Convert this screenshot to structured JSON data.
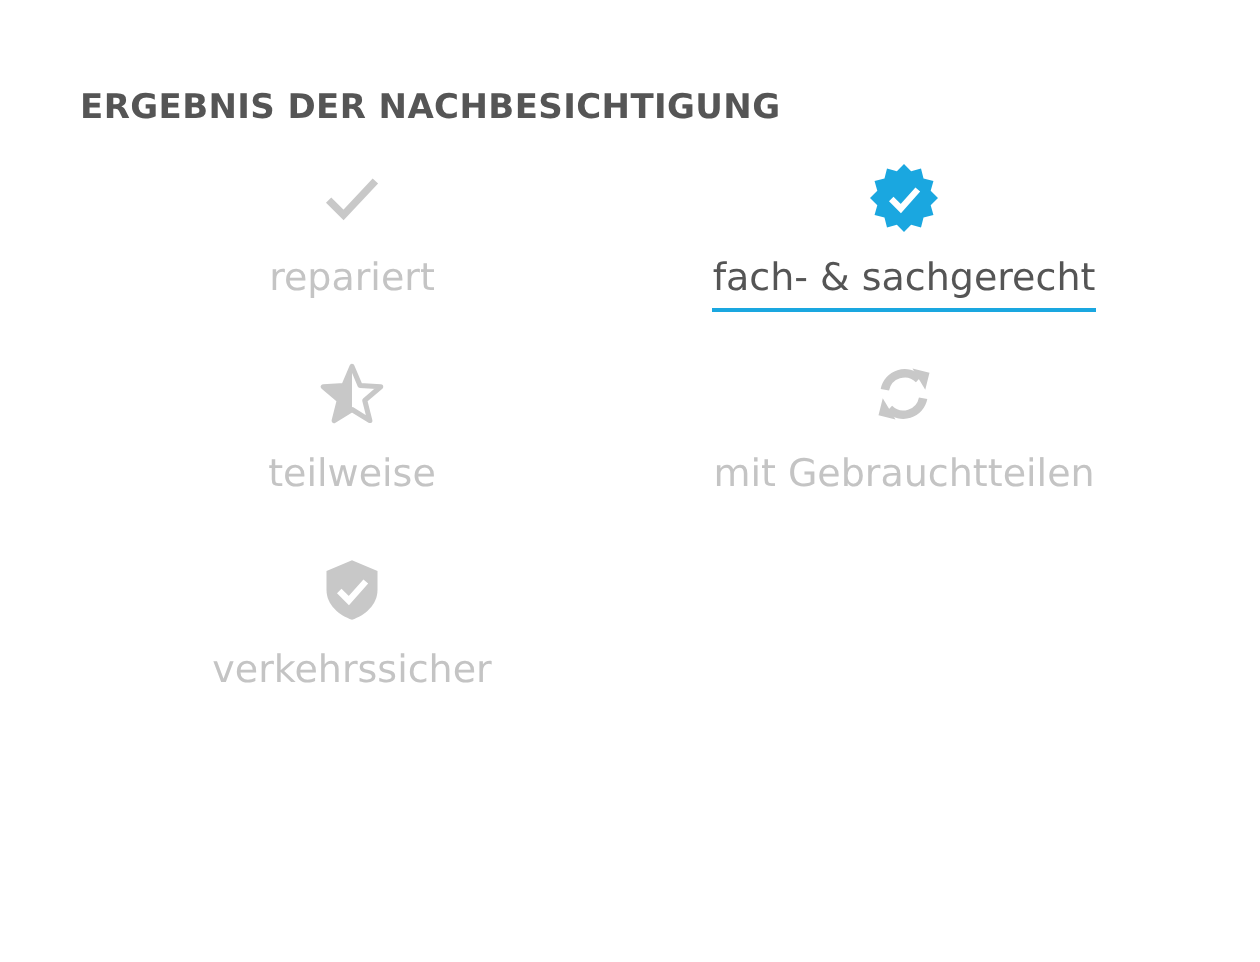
{
  "section": {
    "title": "ERGEBNIS DER NACHBESICHTIGUNG"
  },
  "options": [
    {
      "kind": "check",
      "label": "repariert",
      "selected": false
    },
    {
      "kind": "badge",
      "label": "fach- & sachgerecht",
      "selected": true
    },
    {
      "kind": "star",
      "label": "teilweise",
      "selected": false
    },
    {
      "kind": "refresh",
      "label": "mit Gebrauchtteilen",
      "selected": false
    },
    {
      "kind": "shield",
      "label": "verkehrssicher",
      "selected": false
    }
  ]
}
